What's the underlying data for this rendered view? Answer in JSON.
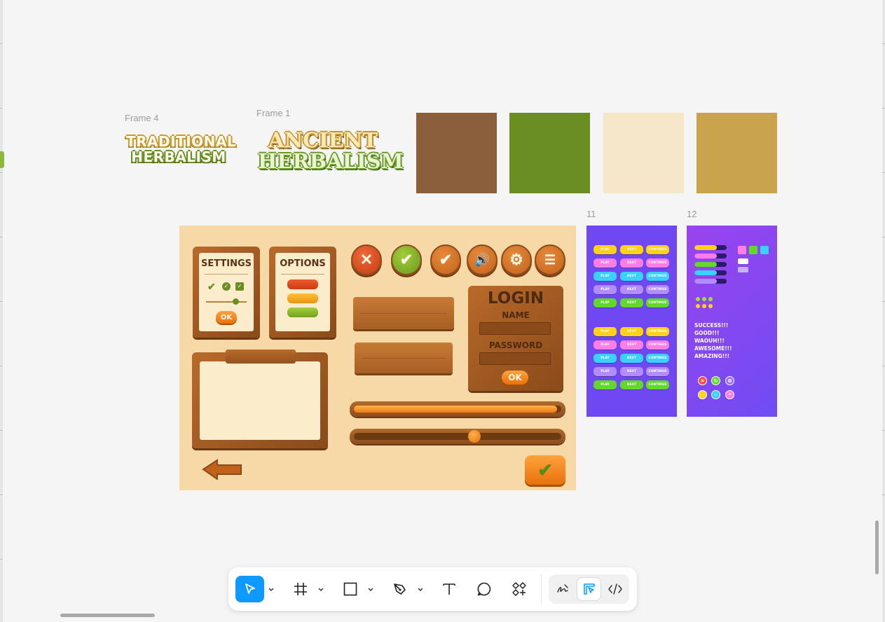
{
  "canvas": {
    "frames": {
      "frame4": "Frame 4",
      "frame1": "Frame 1",
      "frame11": "11",
      "frame12": "12"
    },
    "logos": {
      "traditional": {
        "line1": "TRADITIONAL",
        "line2": "HERBALISM"
      },
      "ancient": {
        "line1": "ANCIENT",
        "line2": "HERBALISM"
      }
    },
    "swatches": [
      "#8b5e3c",
      "#6b8e23",
      "#f5e6c8",
      "#c9a44c"
    ],
    "kit": {
      "settings": "SETTINGS",
      "options": "OPTIONS",
      "login": "LOGIN",
      "name": "NAME",
      "password": "PASSWORD",
      "ok": "OK",
      "progress": 0.98,
      "slider": 0.58
    },
    "purple": {
      "buttons": {
        "play": "PLAY",
        "next": "NEXT",
        "continue": "CONTINUE"
      },
      "messages": [
        "SUCCESS!!!",
        "GOOD!!!",
        "WAOUH!!!",
        "AWESOME!!!",
        "AMAZING!!!"
      ]
    }
  },
  "toolbar": {
    "tools": [
      "move-tool",
      "frame-tool",
      "shape-tool",
      "pen-tool",
      "text-tool",
      "comment-tool",
      "components-tool"
    ],
    "modes": [
      "draw-mode",
      "design-mode",
      "dev-mode"
    ],
    "active_tool": "move-tool",
    "active_mode": "design-mode"
  }
}
